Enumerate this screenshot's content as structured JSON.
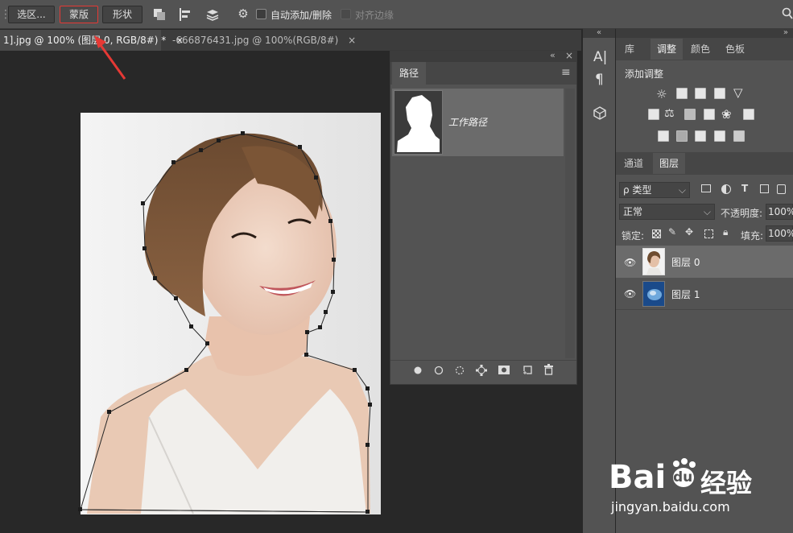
{
  "options_bar": {
    "select_label": "选区...",
    "mask_label": "蒙版",
    "shape_label": "形状",
    "auto_add_delete_label": "自动添加/删除",
    "align_edges_label": "对齐边缘"
  },
  "tabs": [
    {
      "label": "1].jpg @ 100% (图层 0, RGB/8#) *",
      "close": "×"
    },
    {
      "label": "-666876431.jpg @ 100%(RGB/8#)",
      "close": "×"
    }
  ],
  "paths_panel": {
    "title": "路径",
    "work_path_label": "工作路径",
    "collapse_glyph": "«",
    "close_glyph": "×",
    "menu_glyph": "≡"
  },
  "right_panel": {
    "top_tabs": [
      "库",
      "调整",
      "颜色",
      "色板"
    ],
    "add_adjustment_label": "添加调整",
    "layer_tabs": [
      "通道",
      "图层"
    ],
    "filter_kind_label": "ρ 类型",
    "blend_mode": "正常",
    "opacity_label": "不透明度:",
    "opacity_value": "100%",
    "lock_label": "锁定:",
    "fill_label": "填充:",
    "fill_value": "100%",
    "layers": [
      {
        "name": "图层 0",
        "selected": true
      },
      {
        "name": "图层 1",
        "selected": false
      }
    ]
  },
  "watermark": {
    "brand": "Bai",
    "brand2": "du",
    "site_cn": "经验",
    "url": "jingyan.baidu.com"
  },
  "colors": {
    "accent_red": "#e53935",
    "panel_bg": "#535353",
    "selected_layer_bg": "#6b6b6b"
  }
}
